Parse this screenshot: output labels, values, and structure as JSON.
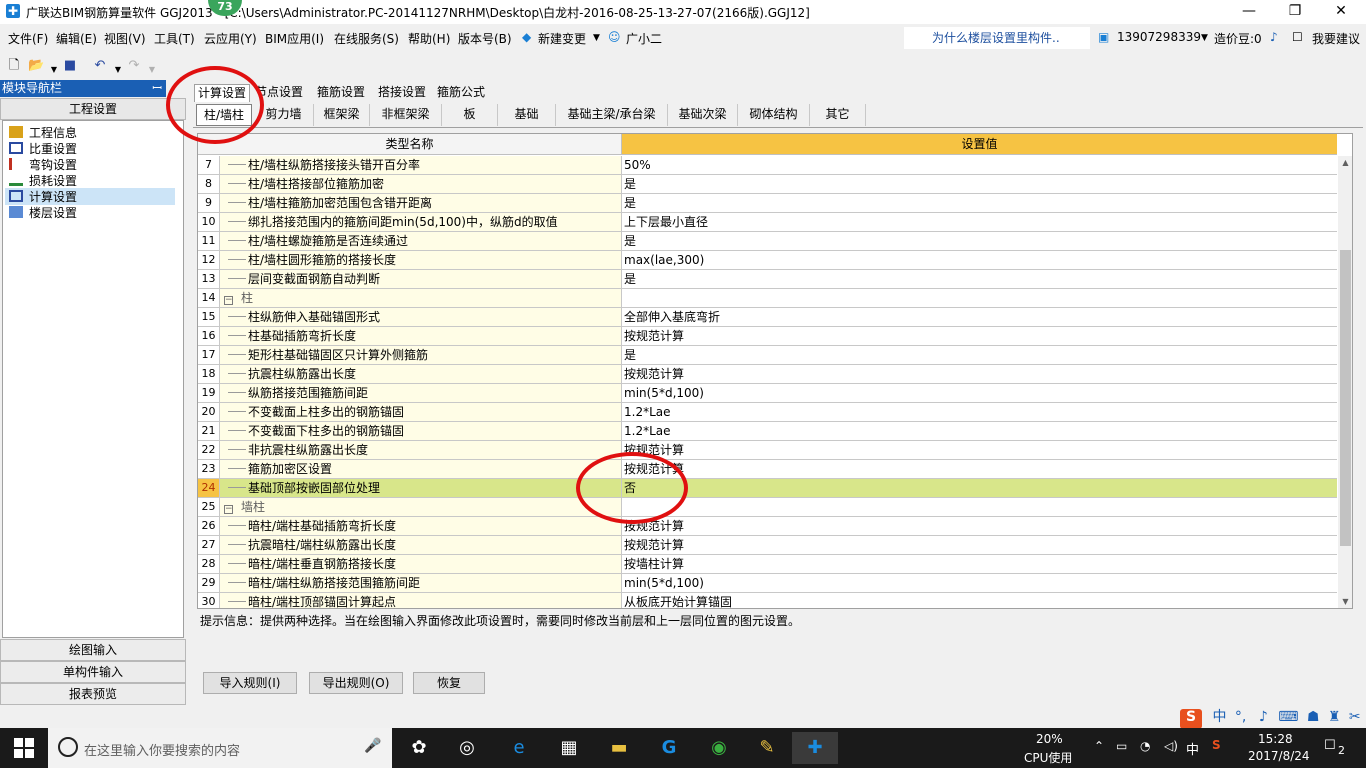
{
  "window": {
    "title": "广联达BIM钢筋算量软件 GGJ2013 - [C:\\Users\\Administrator.PC-20141127NRHM\\Desktop\\白龙村-2016-08-25-13-27-07(2166版).GGJ12]",
    "badge": "73",
    "controls": {
      "minimize": "—",
      "restore": "❐",
      "close": "✕"
    }
  },
  "menu": [
    "文件(F)",
    "编辑(E)",
    "视图(V)",
    "工具(T)",
    "云应用(Y)",
    "BIM应用(I)",
    "在线服务(S)",
    "帮助(H)",
    "版本号(B)",
    "新建变更",
    "广小二"
  ],
  "hint_box": "为什么楼层设置里构件..",
  "user": {
    "phone": "13907298339",
    "points": "造价豆:0",
    "feedback": "我要建议"
  },
  "nav": {
    "header": "模块导航栏",
    "pin": "ꟷ",
    "section": "工程设置",
    "items": [
      "工程信息",
      "比重设置",
      "弯钩设置",
      "损耗设置",
      "计算设置",
      "楼层设置"
    ],
    "bottom": [
      "绘图输入",
      "单构件输入",
      "报表预览"
    ]
  },
  "top_tabs": [
    "计算设置",
    "节点设置",
    "箍筋设置",
    "搭接设置",
    "箍筋公式"
  ],
  "sub_tabs": [
    "柱/墙柱",
    "剪力墙",
    "框架梁",
    "非框架梁",
    "板",
    "基础",
    "基础主梁/承台梁",
    "基础次梁",
    "砌体结构",
    "其它"
  ],
  "grid": {
    "col_name": "类型名称",
    "col_value": "设置值",
    "rows": [
      {
        "n": "7",
        "name": "柱/墙柱纵筋搭接接头错开百分率",
        "value": "50%"
      },
      {
        "n": "8",
        "name": "柱/墙柱搭接部位箍筋加密",
        "value": "是"
      },
      {
        "n": "9",
        "name": "柱/墙柱箍筋加密范围包含错开距离",
        "value": "是"
      },
      {
        "n": "10",
        "name": "绑扎搭接范围内的箍筋间距min(5d,100)中，纵筋d的取值",
        "value": "上下层最小直径"
      },
      {
        "n": "11",
        "name": "柱/墙柱螺旋箍筋是否连续通过",
        "value": "是"
      },
      {
        "n": "12",
        "name": "柱/墙柱圆形箍筋的搭接长度",
        "value": "max(lae,300)"
      },
      {
        "n": "13",
        "name": "层间变截面钢筋自动判断",
        "value": "是"
      },
      {
        "n": "14",
        "name": "柱",
        "value": "",
        "group": true
      },
      {
        "n": "15",
        "name": "柱纵筋伸入基础锚固形式",
        "value": "全部伸入基底弯折"
      },
      {
        "n": "16",
        "name": "柱基础插筋弯折长度",
        "value": "按规范计算"
      },
      {
        "n": "17",
        "name": "矩形柱基础锚固区只计算外侧箍筋",
        "value": "是"
      },
      {
        "n": "18",
        "name": "抗震柱纵筋露出长度",
        "value": "按规范计算"
      },
      {
        "n": "19",
        "name": "纵筋搭接范围箍筋间距",
        "value": "min(5*d,100)"
      },
      {
        "n": "20",
        "name": "不变截面上柱多出的钢筋锚固",
        "value": "1.2*Lae"
      },
      {
        "n": "21",
        "name": "不变截面下柱多出的钢筋锚固",
        "value": "1.2*Lae"
      },
      {
        "n": "22",
        "name": "非抗震柱纵筋露出长度",
        "value": "按规范计算"
      },
      {
        "n": "23",
        "name": "箍筋加密区设置",
        "value": "按规范计算"
      },
      {
        "n": "24",
        "name": "基础顶部按嵌固部位处理",
        "value": "否",
        "selected": true
      },
      {
        "n": "25",
        "name": "墙柱",
        "value": "",
        "group": true
      },
      {
        "n": "26",
        "name": "暗柱/端柱基础插筋弯折长度",
        "value": "按规范计算"
      },
      {
        "n": "27",
        "name": "抗震暗柱/端柱纵筋露出长度",
        "value": "按规范计算"
      },
      {
        "n": "28",
        "name": "暗柱/端柱垂直钢筋搭接长度",
        "value": "按墙柱计算"
      },
      {
        "n": "29",
        "name": "暗柱/端柱纵筋搭接范围箍筋间距",
        "value": "min(5*d,100)"
      },
      {
        "n": "30",
        "name": "暗柱/端柱顶部锚固计算起点",
        "value": "从板底开始计算锚固"
      }
    ]
  },
  "hint": "提示信息：提供两种选择。当在绘图输入界面修改此项设置时，需要同时修改当前层和上一层同位置的图元设置。",
  "buttons": {
    "import": "导入规则(I)",
    "export": "导出规则(O)",
    "restore": "恢复"
  },
  "ime": {
    "lang": "中",
    "symbols": "°,"
  },
  "taskbar": {
    "search_placeholder": "在这里输入你要搜索的内容",
    "cpu_percent": "20%",
    "cpu_label": "CPU使用",
    "lang": "中",
    "time": "15:28",
    "date": "2017/8/24",
    "notifications": "2"
  }
}
